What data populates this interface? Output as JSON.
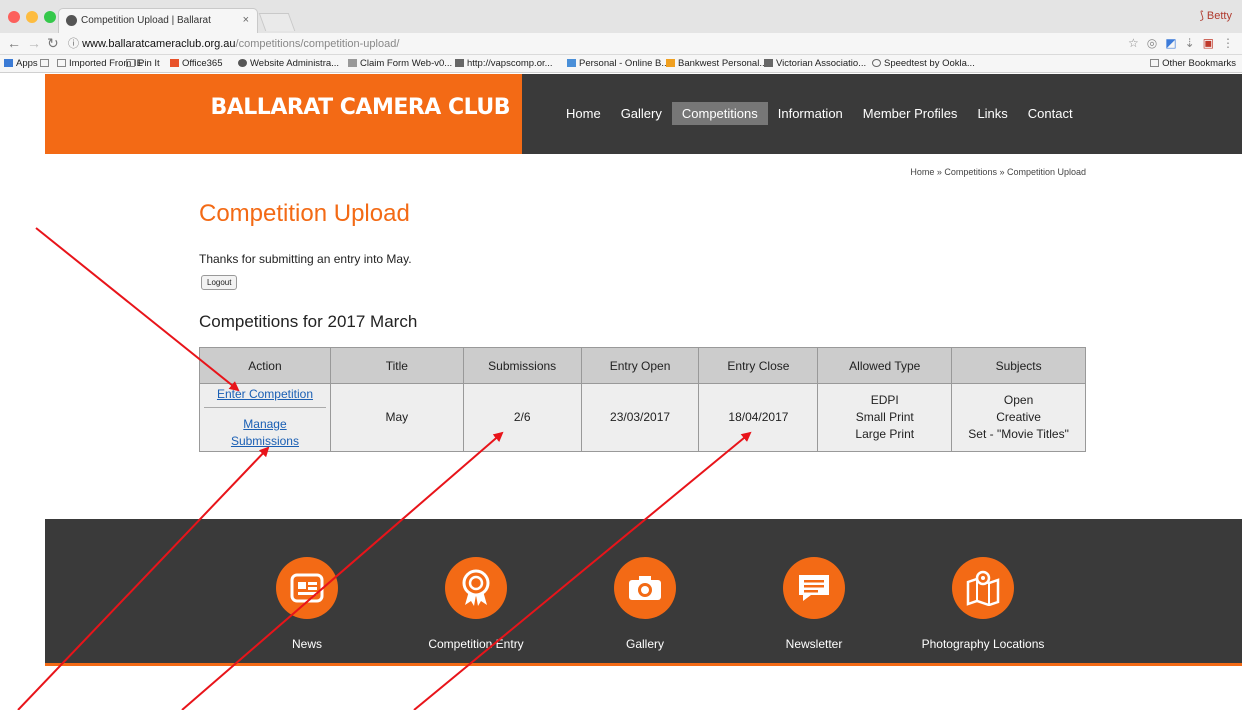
{
  "browser": {
    "tab_title": "Competition Upload | Ballarat",
    "tab_close": "×",
    "profile_name": "Betty",
    "url_host": "www.ballaratcameraclub.org.au",
    "url_path": "/competitions/competition-upload/",
    "bookmarks": [
      "Apps",
      "Imported From IE",
      "Pin It",
      "Office365",
      "Website Administra...",
      "Claim Form Web-v0...",
      "http://vapscomp.or...",
      "Personal - Online B...",
      "Bankwest Personal...",
      "Victorian Associatio...",
      "Speedtest by Ookla..."
    ],
    "other_bookmarks": "Other Bookmarks"
  },
  "site": {
    "brand": "BALLARAT CAMERA CLUB",
    "nav": [
      "Home",
      "Gallery",
      "Competitions",
      "Information",
      "Member Profiles",
      "Links",
      "Contact"
    ],
    "active_nav": "Competitions",
    "accent": "#f36a15",
    "dark": "#3a3a3a"
  },
  "breadcrumb": "Home » Competitions » Competition Upload",
  "page": {
    "title": "Competition Upload",
    "thanks": "Thanks for submitting an entry into May.",
    "logout": "Logout",
    "heading": "Competitions for 2017 March"
  },
  "table": {
    "headers": [
      "Action",
      "Title",
      "Submissions",
      "Entry Open",
      "Entry Close",
      "Allowed Type",
      "Subjects"
    ],
    "row": {
      "enter": "Enter Competition",
      "manage": "Manage Submissions",
      "title": "May",
      "submissions": "2/6",
      "open": "23/03/2017",
      "close": "18/04/2017",
      "types": [
        "EDPI",
        "Small Print",
        "Large Print"
      ],
      "subjects": [
        "Open",
        "Creative",
        "Set - \"Movie Titles\""
      ]
    }
  },
  "footer": [
    {
      "label": "News",
      "icon": "news-icon"
    },
    {
      "label": "Competition Entry",
      "icon": "award-icon"
    },
    {
      "label": "Gallery",
      "icon": "camera-icon"
    },
    {
      "label": "Newsletter",
      "icon": "chat-icon"
    },
    {
      "label": "Photography Locations",
      "icon": "map-icon"
    }
  ]
}
